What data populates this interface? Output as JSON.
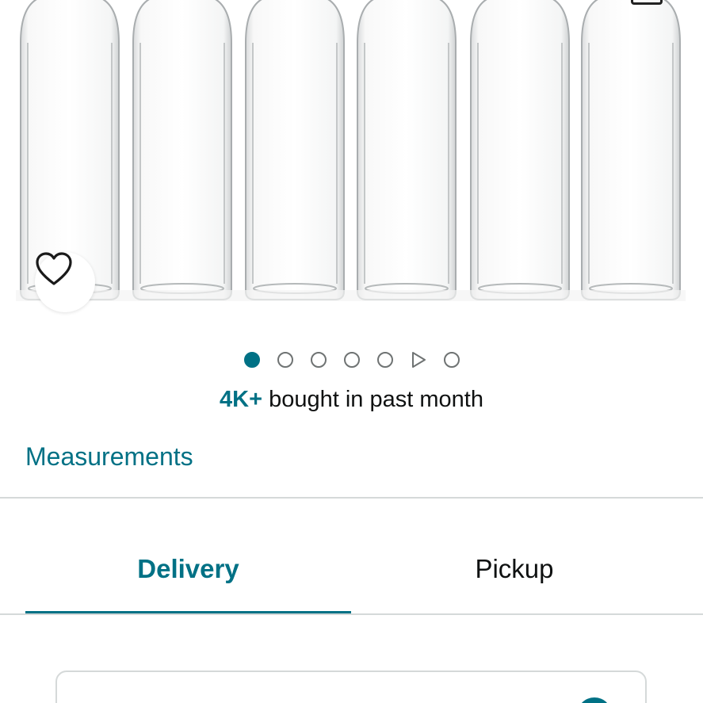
{
  "product": {
    "image_alt": "Set of six clear glass bottles",
    "wishlist_icon": "heart-icon"
  },
  "carousel": {
    "dots": [
      {
        "type": "image",
        "active": true
      },
      {
        "type": "image",
        "active": false
      },
      {
        "type": "image",
        "active": false
      },
      {
        "type": "image",
        "active": false
      },
      {
        "type": "image",
        "active": false
      },
      {
        "type": "video",
        "active": false
      },
      {
        "type": "image",
        "active": false
      }
    ]
  },
  "social_proof": {
    "highlight": "4K+",
    "text": " bought in past month"
  },
  "measurements_link": "Measurements",
  "tabs": {
    "delivery": "Delivery",
    "pickup": "Pickup",
    "selected": "delivery"
  },
  "colors": {
    "accent": "#007185",
    "text": "#0f1111",
    "divider": "#d5d9d9"
  }
}
